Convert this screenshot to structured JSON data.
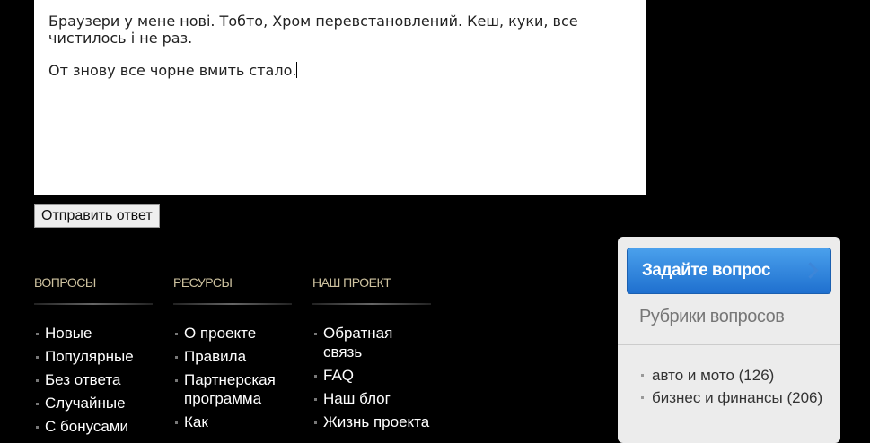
{
  "answer": {
    "paragraphs": [
      "Браузери у мене нові. Тобто, Хром перевстановлений. Кеш, куки, все чистилось і не раз.",
      "От знову все чорне вмить стало."
    ]
  },
  "submit_label": "Отправить ответ",
  "footer": {
    "columns": [
      {
        "title": "ВОПРОСЫ",
        "items": [
          "Новые",
          "Популярные",
          "Без ответа",
          "Случайные",
          "С бонусами"
        ]
      },
      {
        "title": "РЕСУРСЫ",
        "items": [
          "О проекте",
          "Правила",
          "Партнерская программа",
          "Как"
        ]
      },
      {
        "title": "НАШ ПРОЕКТ",
        "items": [
          "Обратная связь",
          "FAQ",
          "Наш блог",
          "Жизнь проекта"
        ]
      }
    ]
  },
  "sidebar": {
    "ask_button": "Задайте вопрос",
    "rubrics_title": "Рубрики вопросов",
    "rubrics": [
      "авто и мото (126)",
      "бизнес и финансы (206)"
    ]
  }
}
